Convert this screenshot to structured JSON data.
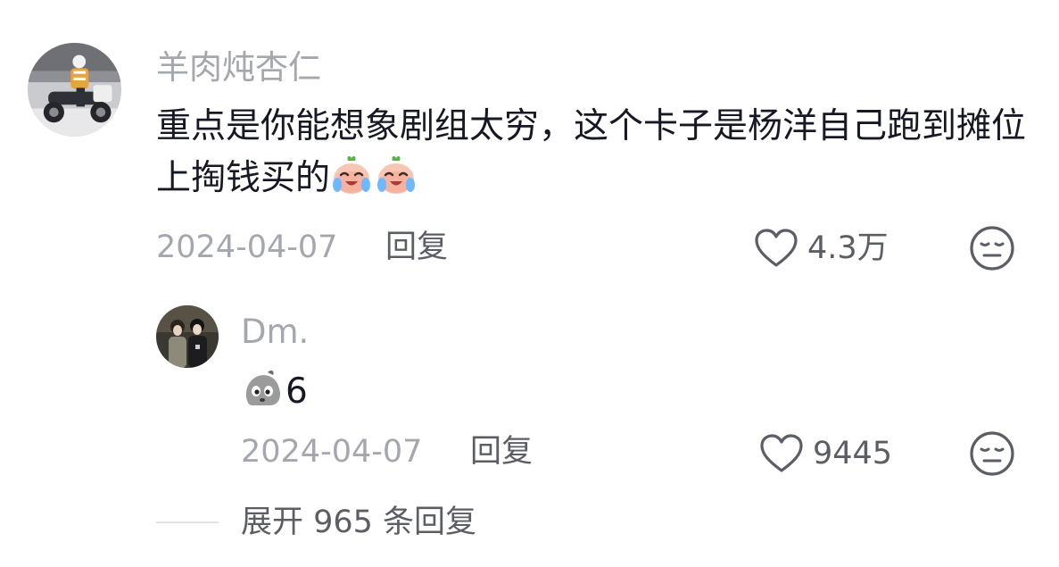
{
  "comment": {
    "username": "羊肉炖杏仁",
    "text": "重点是你能想象剧组太穷，这个卡子是杨洋自己跑到摊位上掏钱买的",
    "emojis": [
      "crying-laughing-peach-emoji",
      "crying-laughing-peach-emoji"
    ],
    "date": "2024-04-07",
    "reply_label": "回复",
    "like_count": "4.3万",
    "avatar": "motorcycle-rider-photo"
  },
  "reply": {
    "username": "Dm.",
    "emoji": "grey-blob-emoji",
    "text": "6",
    "date": "2024-04-07",
    "reply_label": "回复",
    "like_count": "9445",
    "avatar": "two-people-photo"
  },
  "expand": {
    "label": "展开 965 条回复"
  },
  "colors": {
    "text_primary": "#161823",
    "text_secondary": "#a5a7ae",
    "text_action": "#5c5e66",
    "divider": "#e3e3e5"
  },
  "icons": {
    "like": "heart-outline-icon",
    "dislike": "neutral-face-icon"
  }
}
